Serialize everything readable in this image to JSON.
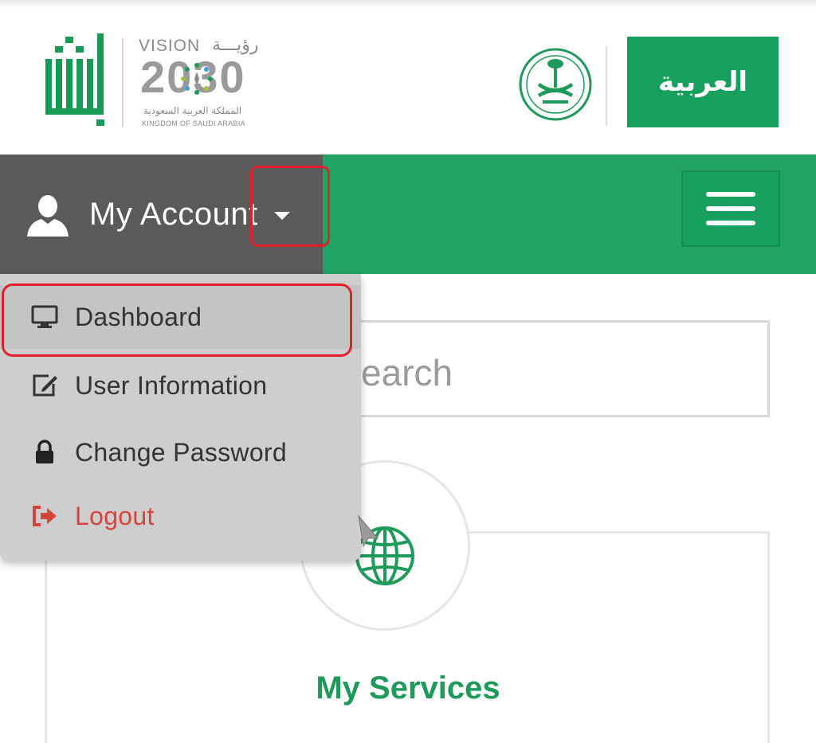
{
  "header": {
    "absher_logo_text": "أبشر",
    "vision": {
      "title": "VISION",
      "title_ar": "رؤيـــة",
      "year": "2030",
      "subtitle_ar": "المملكة العربية السعودية",
      "subtitle_en": "KINGDOM OF SAUDI ARABIA"
    },
    "language_button": "العربية"
  },
  "nav": {
    "account_label": "My Account",
    "account_icon": "user-icon",
    "menu_icon": "hamburger-icon"
  },
  "dropdown": {
    "items": [
      {
        "label": "Dashboard",
        "icon": "monitor-icon"
      },
      {
        "label": "User Information",
        "icon": "edit-icon"
      },
      {
        "label": "Change Password",
        "icon": "lock-icon"
      },
      {
        "label": "Logout",
        "icon": "logout-icon"
      }
    ]
  },
  "main": {
    "search_placeholder": "earch",
    "services_title": "My Services",
    "services_icon": "globe-icon"
  },
  "colors": {
    "brand_green": "#17a05d",
    "nav_gray": "#5a5a5a",
    "dropdown_bg": "#cecece",
    "logout_red": "#d9443a",
    "highlight_red": "#e0202c"
  }
}
